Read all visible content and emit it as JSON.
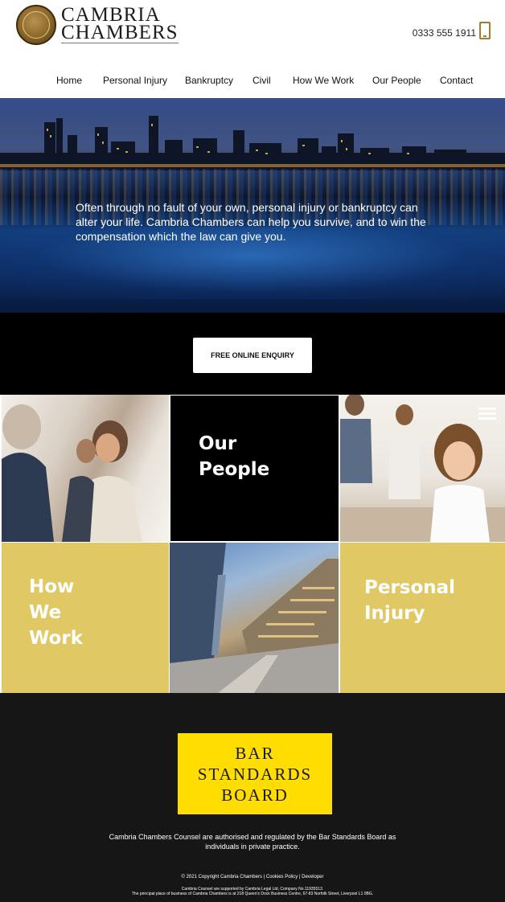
{
  "header": {
    "brand_line1": "CAMBRIA",
    "brand_line2": "CHAMBERS",
    "phone": "0333 555 1911"
  },
  "nav": {
    "items": [
      {
        "label": "Home"
      },
      {
        "label": "Personal Injury"
      },
      {
        "label": "Bankruptcy"
      },
      {
        "label": "Civil"
      },
      {
        "label": "How We Work"
      },
      {
        "label": "Our People"
      },
      {
        "label": "Contact"
      }
    ]
  },
  "hero": {
    "text": "Often through no fault of your own, personal injury or bankruptcy can alter your life. Cambria Chambers can help you survive, and to win the compensation which the law can give you."
  },
  "enquiry": {
    "button_label": "FREE ONLINE ENQUIRY"
  },
  "tiles": {
    "our_people": "Our\nPeople",
    "how_we_work": "How\nWe\nWork",
    "personal_injury": "Personal\nInjury"
  },
  "footer": {
    "bsb_line1": "BAR",
    "bsb_line2": "STANDARDS",
    "bsb_line3": "BOARD",
    "regulation_text": "Cambria Chambers Counsel are authorised and regulated by the Bar Standards Board as individuals in private practice.",
    "copyright": "© 2021 Copyright Cambria Chambers",
    "separator": "|",
    "cookies_link": "Cookies Policy",
    "developer_link": "Developer",
    "small_print_1": "Cambria Counsel are supported by Cambria Legal Ltd, Company No.11935513.",
    "small_print_2": "The principal place of business of Cambria Chambers is at 218 Queen's Dock Business Centre, 67-83 Norfolk Street, Liverpool L1 0BG."
  },
  "colors": {
    "gold_tile": "#e0c965",
    "bsb_yellow": "#ffdd00",
    "footer_bg": "#161616",
    "accent_gold": "#a07d2c"
  },
  "icons": {
    "phone": "mobile-phone-icon",
    "menu": "hamburger-menu-icon",
    "logo": "crest-seal-icon"
  }
}
